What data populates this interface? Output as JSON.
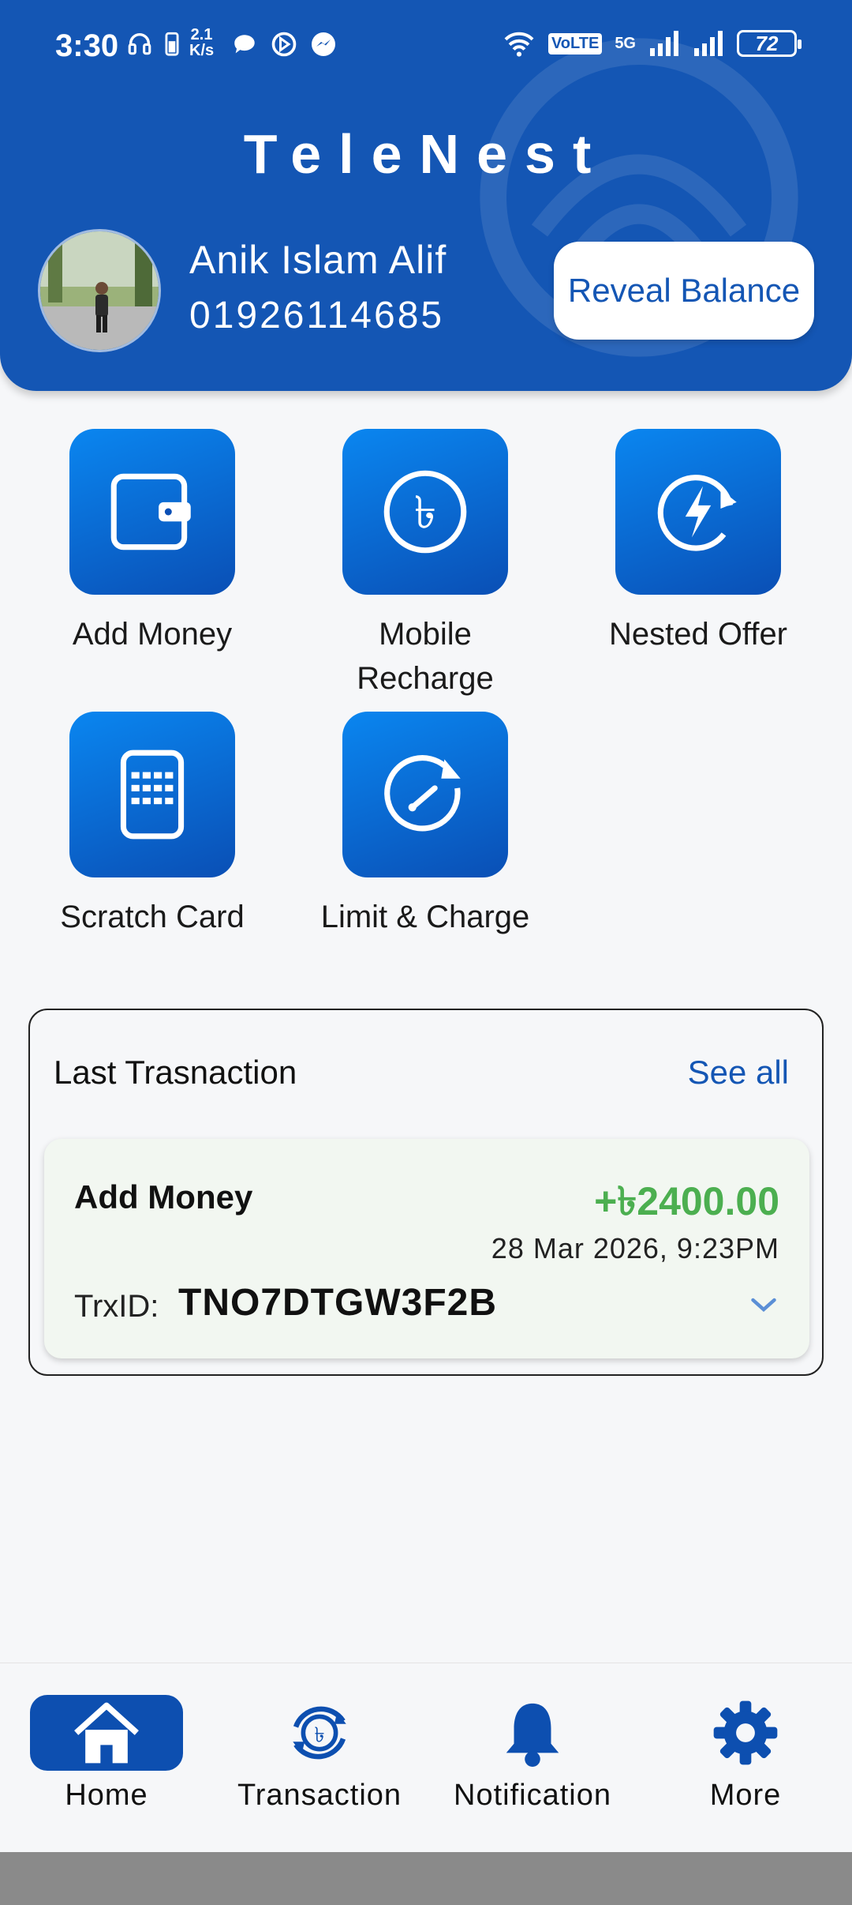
{
  "status_bar": {
    "time": "3:30",
    "net_speed_top": "2.1",
    "net_speed_bottom": "K/s",
    "volte": "VoLTE",
    "signal_5g": "5G",
    "battery": "72"
  },
  "header": {
    "app_title": "TeleNest",
    "user_name": "Anik Islam Alif",
    "user_phone": "01926114685",
    "reveal_button": "Reveal Balance"
  },
  "actions": [
    {
      "label": "Add Money",
      "icon": "wallet-icon"
    },
    {
      "label": "Mobile Recharge",
      "icon": "taka-circle-icon"
    },
    {
      "label": "Nested Offer",
      "icon": "lightning-refresh-icon"
    },
    {
      "label": "Scratch Card",
      "icon": "scratch-card-icon"
    },
    {
      "label": "Limit & Charge",
      "icon": "gauge-icon"
    }
  ],
  "last_transaction": {
    "title": "Last Trasnaction",
    "see_all": "See all",
    "item": {
      "type": "Add Money",
      "amount": "+৳2400.00",
      "date": "28 Mar 2026, 9:23PM",
      "trx_label": "TrxID:",
      "trx_id": "TNO7DTGW3F2B"
    }
  },
  "bottom_nav": [
    {
      "label": "Home",
      "icon": "home-icon",
      "active": true
    },
    {
      "label": "Transaction",
      "icon": "transaction-icon",
      "active": false
    },
    {
      "label": "Notification",
      "icon": "bell-icon",
      "active": false
    },
    {
      "label": "More",
      "icon": "gear-icon",
      "active": false
    }
  ],
  "colors": {
    "primary": "#1456b4",
    "accent_tile_top": "#0a86f0",
    "accent_tile_bottom": "#0a4fb5",
    "amount_green": "#4caf50"
  }
}
